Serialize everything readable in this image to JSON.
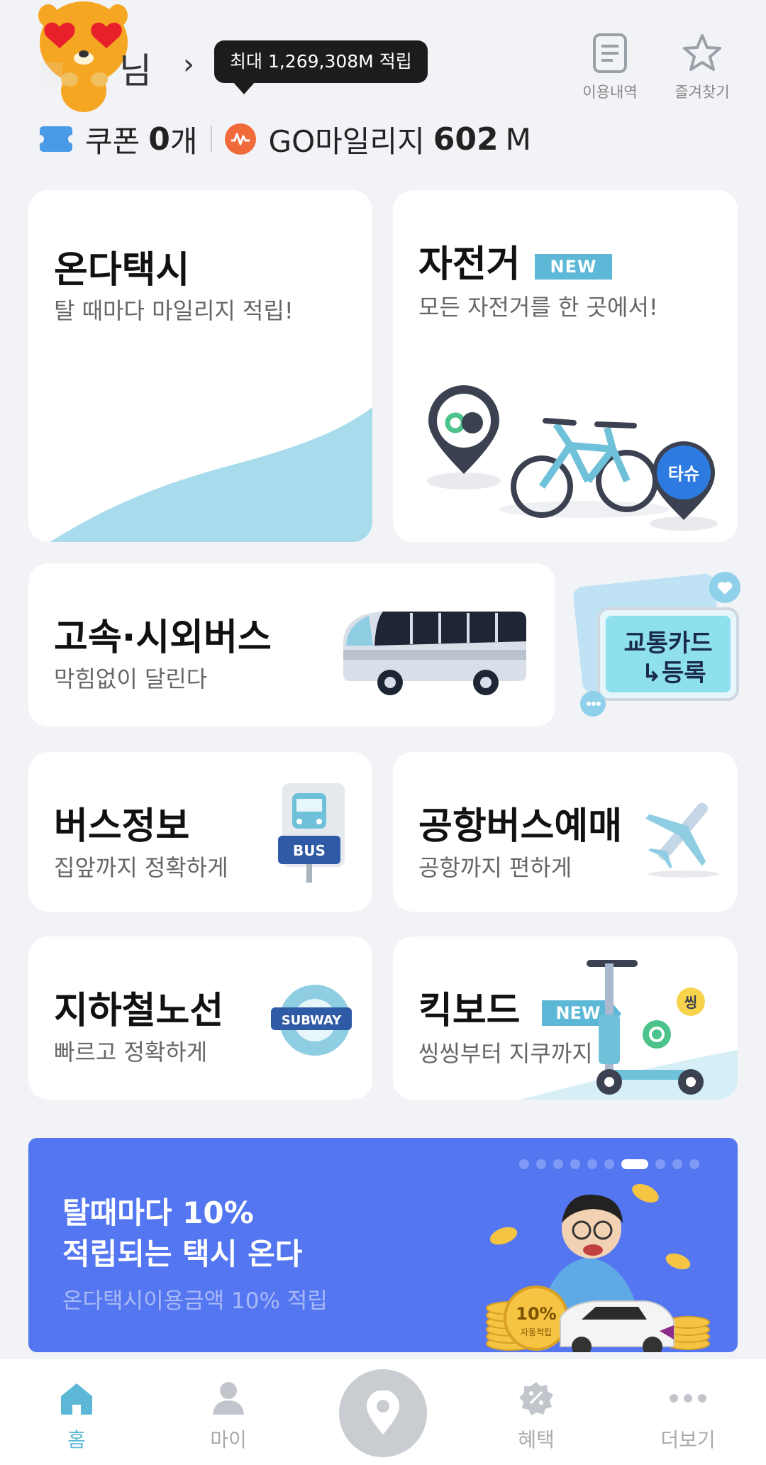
{
  "header": {
    "user_suffix": "님",
    "user_chevron": "›",
    "tooltip": "최대 1,269,308M 적립",
    "history_label": "이용내역",
    "favorites_label": "즐겨찾기",
    "coupon_label": "쿠폰",
    "coupon_count": "0",
    "coupon_unit": "개",
    "mileage_label": "GO마일리지",
    "mileage_value": "602",
    "mileage_unit": "M"
  },
  "cards": {
    "taxi": {
      "title": "온다택시",
      "sub": "탈 때마다 마일리지 적립!"
    },
    "bike": {
      "title": "자전거",
      "badge": "NEW",
      "sub": "모든 자전거를 한 곳에서!",
      "pin_text": "타슈"
    },
    "bus": {
      "title": "고속·시외버스",
      "sub": "막힘없이 달린다"
    },
    "card_reg": {
      "line1": "교통카드",
      "line2": "↳등록"
    },
    "bus_info": {
      "title": "버스정보",
      "sub": "집앞까지 정확하게",
      "sign_text": "BUS"
    },
    "airport": {
      "title": "공항버스예매",
      "sub": "공항까지 편하게"
    },
    "subway": {
      "title": "지하철노선",
      "sub": "빠르고 정확하게",
      "sign_text": "SUBWAY"
    },
    "kickboard": {
      "title": "킥보드",
      "badge": "NEW",
      "sub": "씽씽부터 지쿠까지",
      "logo_text": "씽"
    }
  },
  "banner": {
    "line1": "탈때마다 10%",
    "line2": "적립되는 택시 온다",
    "line3": "온다택시이용금액 10% 적립",
    "coin_text": "10%",
    "coin_sub": "자동적립",
    "dot_count": 10,
    "active_dot_index": 6
  },
  "bottom_nav": {
    "home": "홈",
    "my": "마이",
    "benefit": "혜택",
    "more": "더보기"
  },
  "colors": {
    "accent": "#5cb8d6",
    "banner_bg": "#5476f0",
    "page_bg": "#f2f3f6"
  }
}
